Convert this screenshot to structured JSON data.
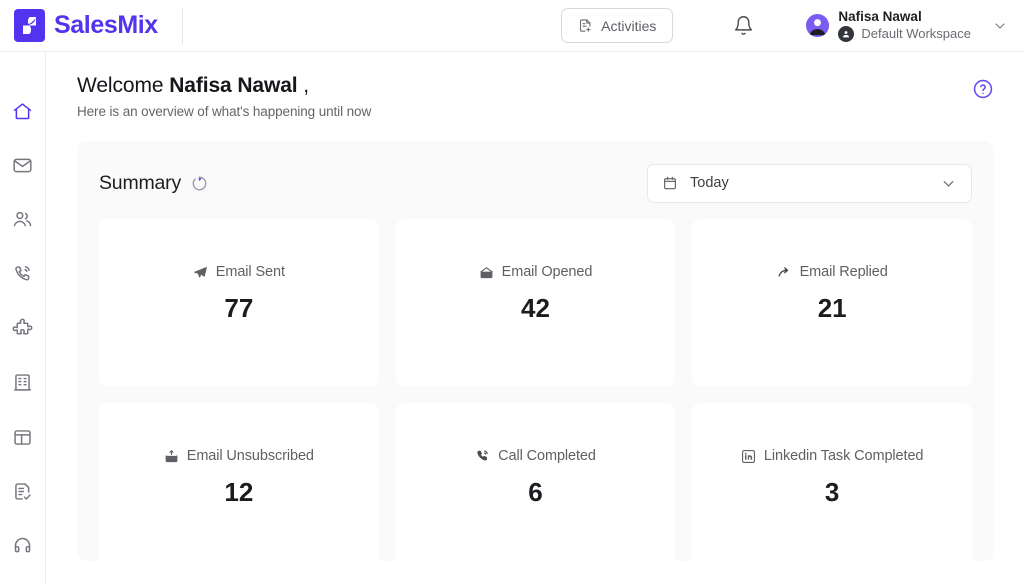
{
  "brand": {
    "name": "SalesMix",
    "logo_icon": "salesmix-leaf-logo",
    "color": "#5333ee"
  },
  "header": {
    "activities_label": "Activities",
    "activities_icon": "document-plus-icon",
    "notifications_icon": "bell-icon",
    "user_name": "Nafisa Nawal",
    "workspace_name": "Default Workspace",
    "avatar_icon": "user-avatar-icon",
    "workspace_icon": "workspace-badge-icon",
    "caret_icon": "chevron-down-icon"
  },
  "sidebar": {
    "items": [
      {
        "name": "home",
        "icon": "home-icon",
        "active": true
      },
      {
        "name": "mail",
        "icon": "envelope-icon",
        "active": false
      },
      {
        "name": "contacts",
        "icon": "people-icon",
        "active": false
      },
      {
        "name": "calls",
        "icon": "phone-call-icon",
        "active": false
      },
      {
        "name": "integrations",
        "icon": "puzzle-icon",
        "active": false
      },
      {
        "name": "companies",
        "icon": "building-icon",
        "active": false
      },
      {
        "name": "board",
        "icon": "table-layout-icon",
        "active": false
      },
      {
        "name": "tasks",
        "icon": "document-check-icon",
        "active": false
      },
      {
        "name": "support",
        "icon": "support-headset-icon",
        "active": false
      }
    ]
  },
  "welcome": {
    "greeting": "Welcome ",
    "user_name": "Nafisa Nawal",
    "comma": " ,",
    "subtitle": "Here is an overview of what's happening until now",
    "help_icon": "help-circle-icon"
  },
  "summary": {
    "title": "Summary",
    "refresh_icon": "refresh-icon",
    "date_filter": {
      "value": "Today",
      "calendar_icon": "calendar-icon",
      "caret_icon": "chevron-down-icon"
    },
    "cards": [
      {
        "label": "Email Sent",
        "value": "77",
        "icon": "paper-plane-icon"
      },
      {
        "label": "Email Opened",
        "value": "42",
        "icon": "envelope-open-icon"
      },
      {
        "label": "Email Replied",
        "value": "21",
        "icon": "reply-arrow-icon"
      },
      {
        "label": "Email Unsubscribed",
        "value": "12",
        "icon": "envelope-up-icon"
      },
      {
        "label": "Call Completed",
        "value": "6",
        "icon": "phone-call-icon"
      },
      {
        "label": "Linkedin Task Completed",
        "value": "3",
        "icon": "linkedin-icon"
      }
    ]
  }
}
